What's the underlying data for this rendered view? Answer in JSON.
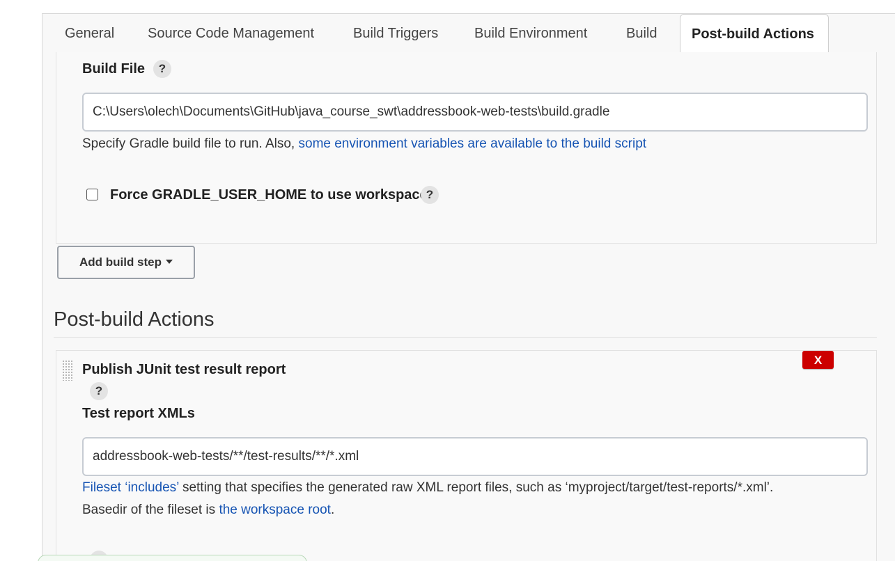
{
  "tabs": [
    {
      "label": "General"
    },
    {
      "label": "Source Code Management"
    },
    {
      "label": "Build Triggers"
    },
    {
      "label": "Build Environment"
    },
    {
      "label": "Build"
    },
    {
      "label": "Post-build Actions",
      "active": true
    }
  ],
  "build_step": {
    "build_file_label": "Build File",
    "build_file_value": "C:\\Users\\olech\\Documents\\GitHub\\java_course_swt\\addressbook-web-tests\\build.gradle",
    "desc_prefix": "Specify Gradle build file to run. Also, ",
    "desc_link": "some environment variables are available to the build script",
    "force_home_label": "Force GRADLE_USER_HOME to use workspace",
    "force_home_checked": false,
    "help_symbol": "?"
  },
  "add_build_step": {
    "label": "Add build step"
  },
  "post_build": {
    "title": "Post-build Actions",
    "junit": {
      "title": "Publish JUnit test result report",
      "delete_label": "X",
      "xml_label": "Test report XMLs",
      "xml_value": "addressbook-web-tests/**/test-results/**/*.xml",
      "desc_link1": "Fileset ‘includes’",
      "desc_text1": " setting that specifies the generated raw XML report files, such as ‘myproject/target/test-reports/*.xml’.",
      "desc_text2": "Basedir of the fileset is ",
      "desc_link2": "the workspace root",
      "desc_text3": "."
    }
  },
  "colors": {
    "link": "#1654b3",
    "delete": "#cc0000",
    "panel_bg": "#f8f8f8"
  }
}
